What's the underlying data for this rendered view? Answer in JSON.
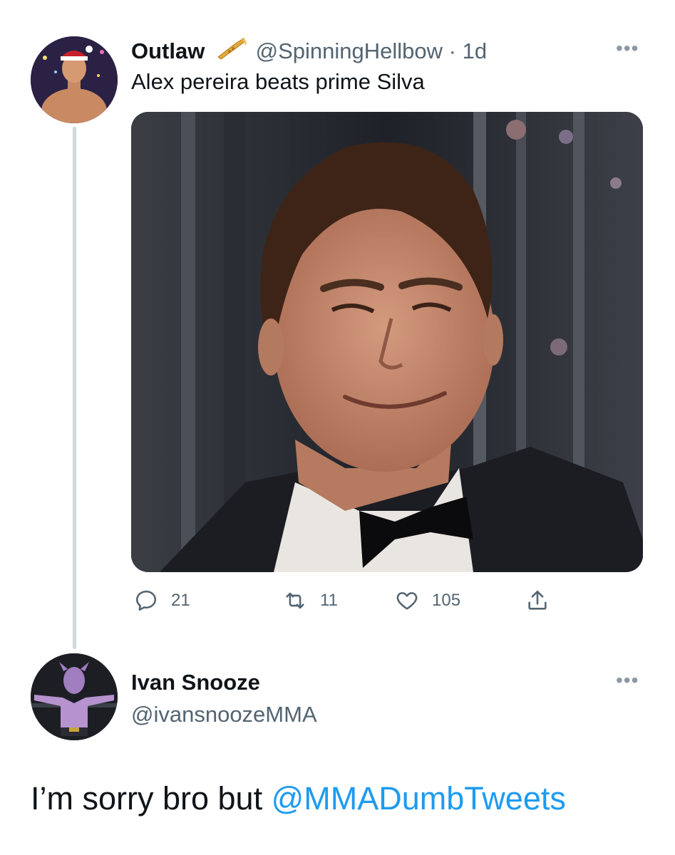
{
  "tweet": {
    "author_name": "Outlaw",
    "author_badge_icon": "trumpet-icon",
    "author_handle": "@SpinningHellbow",
    "separator": "·",
    "time": "1d",
    "text": "Alex pereira beats prime Silva",
    "media_description": "",
    "stats": {
      "replies": "21",
      "retweets": "11",
      "likes": "105"
    },
    "more_label": "•••"
  },
  "reply": {
    "author_name": "Ivan Snooze",
    "author_handle": "@ivansnoozeMMA",
    "more_label": "•••",
    "text_before": "I’m sorry bro but ",
    "mention": "@MMADumbTweets"
  },
  "colors": {
    "accent": "#1d9bf0",
    "secondary_text": "#536471",
    "thread_line": "#cfd9de"
  }
}
